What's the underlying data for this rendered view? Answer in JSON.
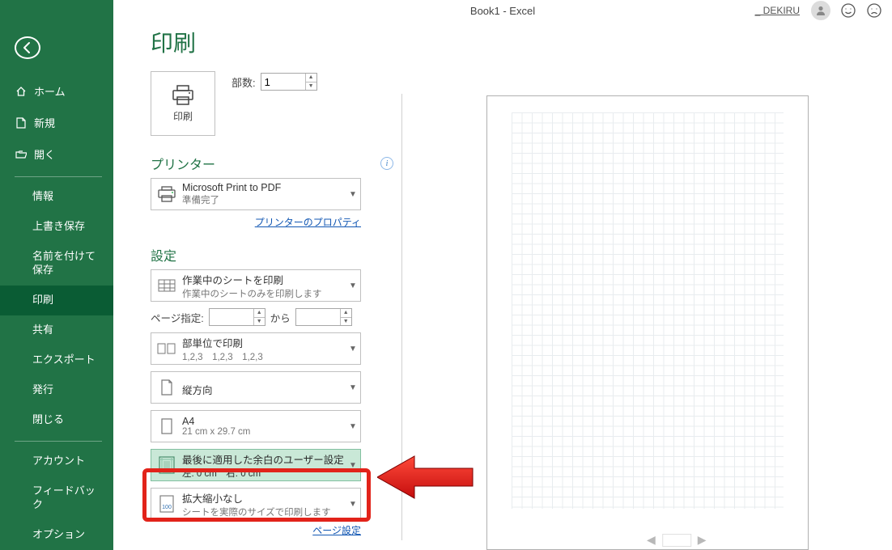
{
  "titlebar": {
    "doc": "Book1  -  Excel",
    "account": "_ DEKIRU"
  },
  "sidebar": {
    "home": "ホーム",
    "new": "新規",
    "open": "開く",
    "info": "情報",
    "save": "上書き保存",
    "saveas": "名前を付けて保存",
    "print": "印刷",
    "share": "共有",
    "export": "エクスポート",
    "publish": "発行",
    "close": "閉じる",
    "account": "アカウント",
    "feedback": "フィードバック",
    "options": "オプション"
  },
  "page": {
    "title": "印刷",
    "printbtn": "印刷",
    "copies_label": "部数:",
    "copies_value": "1",
    "printer_head": "プリンター",
    "printer_name": "Microsoft Print to PDF",
    "printer_status": "準備完了",
    "printer_props": "プリンターのプロパティ",
    "settings_head": "設定",
    "what_line1": "作業中のシートを印刷",
    "what_line2": "作業中のシートのみを印刷します",
    "pages_label": "ページ指定:",
    "pages_to": "から",
    "collate_line1": "部単位で印刷",
    "collate_line2": "1,2,3　1,2,3　1,2,3",
    "orient_line1": "縦方向",
    "paper_line1": "A4",
    "paper_line2": "21 cm x 29.7 cm",
    "margins_line1": "最後に適用した余白のユーザー設定",
    "margins_line2": "左:  0 cm　右:  0 cm",
    "scale_line1": "拡大縮小なし",
    "scale_line2": "シートを実際のサイズで印刷します",
    "page_setup": "ページ設定"
  }
}
